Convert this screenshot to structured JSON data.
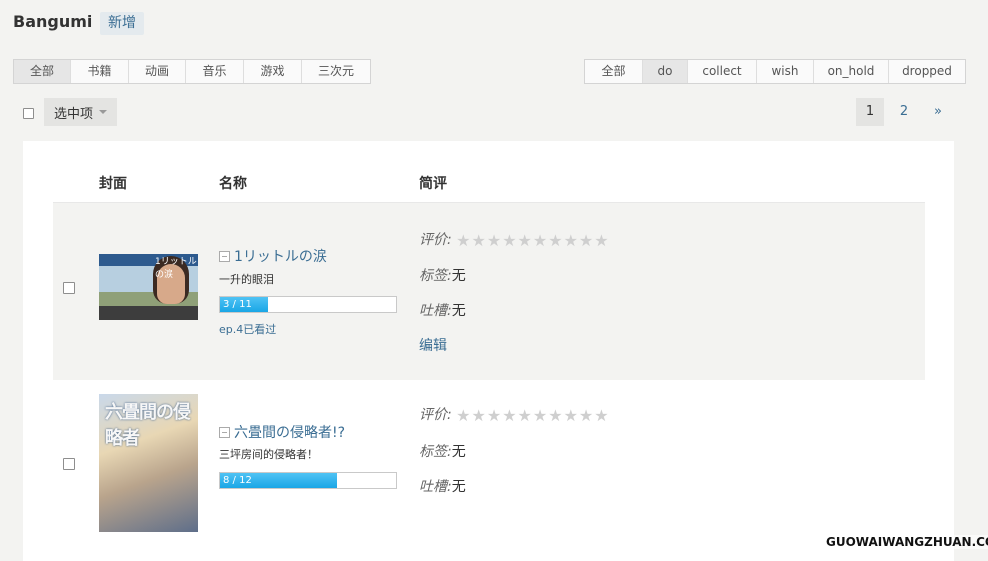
{
  "header": {
    "title": "Bangumi",
    "add_label": "新增"
  },
  "type_tabs": [
    "全部",
    "书籍",
    "动画",
    "音乐",
    "游戏",
    "三次元"
  ],
  "status_tabs": [
    "全部",
    "do",
    "collect",
    "wish",
    "on_hold",
    "dropped"
  ],
  "active": {
    "type_tab": "全部",
    "status_tab": "do"
  },
  "bulk": {
    "select_label": "选中项"
  },
  "pagination": {
    "pages": [
      "1",
      "2"
    ],
    "current": "1",
    "next": "»"
  },
  "table": {
    "columns": {
      "cover": "封面",
      "name": "名称",
      "review": "简评"
    }
  },
  "labels": {
    "rating": "评价:",
    "tags": "标签:",
    "comment": "吐槽:",
    "edit": "编辑"
  },
  "items": [
    {
      "title": "1リットルの涙",
      "cover_text": "1リットルの涙",
      "subtitle": "一升的眼泪",
      "progress_text": "3 / 11",
      "progress_fraction": 0.2727,
      "last_watched": "ep.4已看过",
      "tags": "无",
      "comment": "无",
      "stars_total": 10,
      "stars_filled": 0
    },
    {
      "title": "六畳間の侵略者!?",
      "cover_text": "六畳間の侵略者",
      "subtitle": "三坪房间的侵略者！",
      "progress_text": "8 / 12",
      "progress_fraction": 0.6667,
      "tags": "无",
      "comment": "无",
      "stars_total": 10,
      "stars_filled": 0
    }
  ],
  "watermark": "GUOWAIWANGZHUAN.COM",
  "colors": {
    "link": "#3a6d93",
    "progress": "#1aa6e6",
    "star_empty": "#cfcfcf"
  }
}
